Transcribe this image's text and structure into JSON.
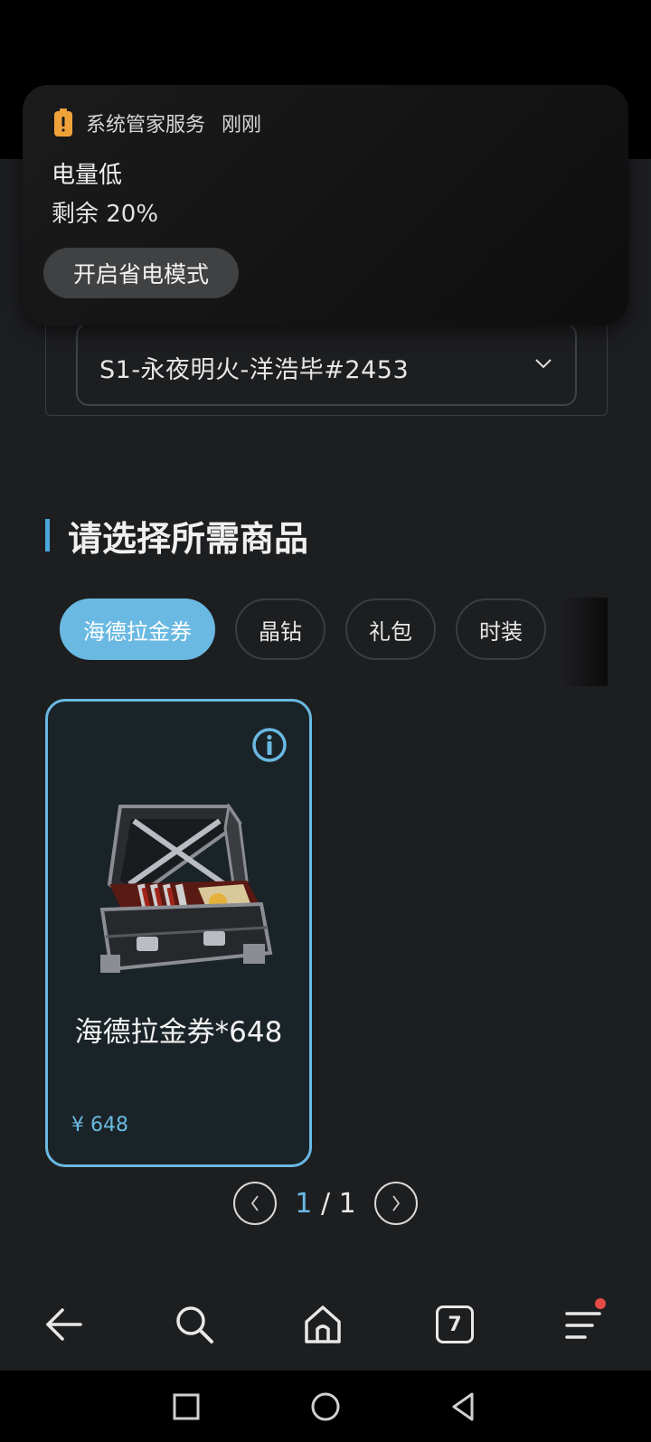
{
  "notification": {
    "app_name": "系统管家服务",
    "time": "刚刚",
    "title": "电量低",
    "body": "剩余 20%",
    "action_label": "开启省电模式",
    "icon": "battery-low-icon",
    "icon_color": "#f0a23a"
  },
  "server_select": {
    "value": "S1-永夜明火-洋浩毕#2453",
    "icon": "chevron-down-icon"
  },
  "section": {
    "title": "请选择所需商品",
    "accent_color": "#4aa8de"
  },
  "tabs": [
    {
      "label": "海德拉金券",
      "active": true
    },
    {
      "label": "晶钻",
      "active": false
    },
    {
      "label": "礼包",
      "active": false
    },
    {
      "label": "时装",
      "active": false
    }
  ],
  "products": [
    {
      "name": "海德拉金券*648",
      "price": "¥ 648",
      "icon": "info-icon",
      "image": "briefcase-item"
    }
  ],
  "pagination": {
    "current": "1",
    "separator": "/",
    "total": "1"
  },
  "browser_bar": {
    "tab_count": "7",
    "items": [
      "back-arrow-icon",
      "search-icon",
      "home-icon",
      "tabs-icon",
      "menu-icon"
    ]
  },
  "colors": {
    "accent": "#6ab9e2",
    "background": "#1d1e20",
    "badge": "#e44b44"
  }
}
